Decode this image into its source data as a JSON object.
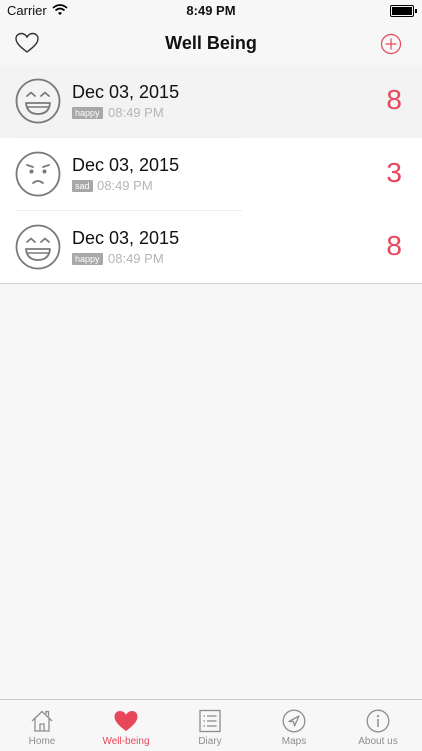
{
  "status_bar": {
    "carrier": "Carrier",
    "time": "8:49 PM"
  },
  "nav": {
    "title": "Well Being",
    "left_icon": "heart-outline-icon",
    "right_icon": "add-circle-icon"
  },
  "entries": [
    {
      "mood_icon": "happy-face-icon",
      "date": "Dec 03, 2015",
      "mood": "happy",
      "time": "08:49 PM",
      "score": "8"
    },
    {
      "mood_icon": "sad-face-icon",
      "date": "Dec 03, 2015",
      "mood": "sad",
      "time": "08:49 PM",
      "score": "3"
    },
    {
      "mood_icon": "happy-face-icon",
      "date": "Dec 03, 2015",
      "mood": "happy",
      "time": "08:49 PM",
      "score": "8"
    }
  ],
  "tabs": [
    {
      "label": "Home",
      "icon": "home-icon"
    },
    {
      "label": "Well-being",
      "icon": "heart-icon",
      "active": true
    },
    {
      "label": "Diary",
      "icon": "list-icon"
    },
    {
      "label": "Maps",
      "icon": "location-arrow-icon"
    },
    {
      "label": "About us",
      "icon": "info-icon"
    }
  ],
  "colors": {
    "accent": "#e8465a",
    "badge": "#a8a8a8",
    "icon_gray": "#7a7a7a"
  }
}
